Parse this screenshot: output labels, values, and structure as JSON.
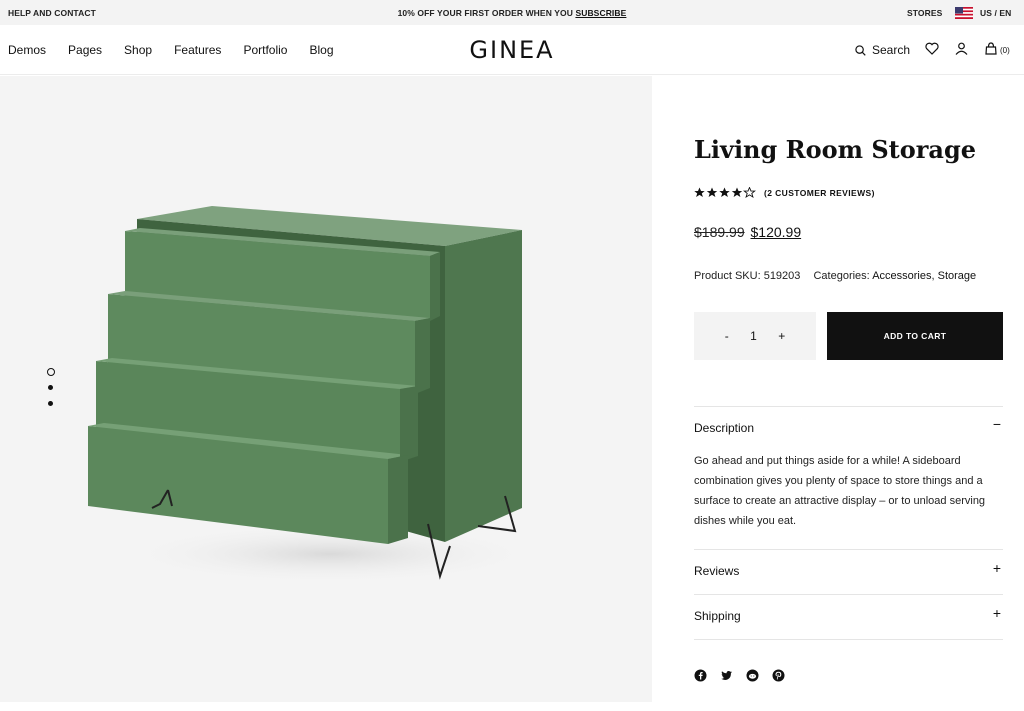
{
  "topbar": {
    "help": "HELP AND CONTACT",
    "promo_text": "10% OFF YOUR FIRST ORDER WHEN YOU ",
    "promo_link": "SUBSCRIBE",
    "stores": "STORES",
    "locale": "US / EN"
  },
  "header": {
    "nav": [
      "Demos",
      "Pages",
      "Shop",
      "Features",
      "Portfolio",
      "Blog"
    ],
    "logo": "GINEA",
    "search_label": "Search",
    "cart_count": "(0)"
  },
  "gallery": {
    "slides": 3,
    "active_slide": 1
  },
  "product": {
    "title": "Living Room Storage",
    "rating": 4,
    "rating_max": 5,
    "reviews_label": "(2 CUSTOMER REVIEWS)",
    "old_price": "$189.99",
    "new_price": "$120.99",
    "sku_label": "Product SKU: 519203",
    "categories_label": "Categories:",
    "categories": [
      "Accessories",
      "Storage"
    ],
    "qty_minus": "-",
    "qty_value": "1",
    "qty_plus": "+",
    "add_to_cart": "ADD TO CART"
  },
  "accordion": {
    "description_title": "Description",
    "description_toggle": "−",
    "description_text": "Go ahead and put things aside for a while! A sideboard combination gives you plenty of space to store things and a surface to create an attractive display – or to unload serving dishes while you eat.",
    "reviews_title": "Reviews",
    "reviews_toggle": "+",
    "shipping_title": "Shipping",
    "shipping_toggle": "+"
  },
  "colors": {
    "accent": "#111111",
    "furniture_green": "#5e8a5e",
    "gallery_bg": "#f4f4f4"
  },
  "socials": [
    "facebook-icon",
    "twitter-icon",
    "reddit-icon",
    "pinterest-icon"
  ]
}
